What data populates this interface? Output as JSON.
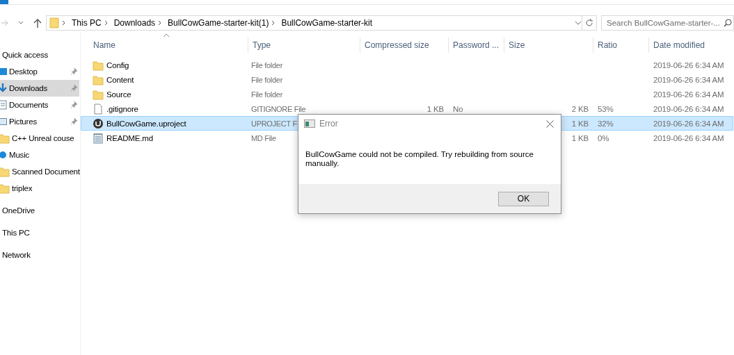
{
  "address_bar": {
    "path": [
      "This PC",
      "Downloads",
      "BullCowGame-starter-kit(1)",
      "BullCowGame-starter-kit"
    ]
  },
  "search": {
    "placeholder": "Search BullCowGame-starter-..."
  },
  "sidebar": {
    "items": [
      {
        "label": "Quick access",
        "kind": "header",
        "selected": false,
        "pinned": false
      },
      {
        "label": "Desktop",
        "kind": "desktop",
        "selected": false,
        "pinned": true
      },
      {
        "label": "Downloads",
        "kind": "downloads",
        "selected": true,
        "pinned": true
      },
      {
        "label": "Documents",
        "kind": "documents",
        "selected": false,
        "pinned": true
      },
      {
        "label": "Pictures",
        "kind": "pictures",
        "selected": false,
        "pinned": true
      },
      {
        "label": "C++ Unreal couse",
        "kind": "folder",
        "selected": false,
        "pinned": false
      },
      {
        "label": "Music",
        "kind": "music",
        "selected": false,
        "pinned": false
      },
      {
        "label": "Scanned Document",
        "kind": "folder",
        "selected": false,
        "pinned": false
      },
      {
        "label": "triplex",
        "kind": "folder",
        "selected": false,
        "pinned": false
      },
      {
        "label": "OneDrive",
        "kind": "header",
        "selected": false,
        "pinned": false
      },
      {
        "label": "This PC",
        "kind": "header",
        "selected": false,
        "pinned": false
      },
      {
        "label": "Network",
        "kind": "header",
        "selected": false,
        "pinned": false
      }
    ]
  },
  "table": {
    "columns": [
      "Name",
      "Type",
      "Compressed size",
      "Password ...",
      "Size",
      "Ratio",
      "Date modified"
    ],
    "rows": [
      {
        "kind": "folder",
        "selected": false,
        "name": "Config",
        "type": "File folder",
        "date": "2019-06-26 6:34 AM"
      },
      {
        "kind": "folder",
        "selected": false,
        "name": "Content",
        "type": "File folder",
        "date": "2019-06-26 6:34 AM"
      },
      {
        "kind": "folder",
        "selected": false,
        "name": "Source",
        "type": "File folder",
        "date": "2019-06-26 6:34 AM"
      },
      {
        "kind": "file",
        "selected": false,
        "name": ".gitignore",
        "type": "GITIGNORE File",
        "compressed_size": "1 KB",
        "password": "No",
        "size": "2 KB",
        "ratio": "53%",
        "date": "2019-06-26 6:34 AM"
      },
      {
        "kind": "unreal",
        "selected": true,
        "name": "BullCowGame.uproject",
        "type": "UPROJECT F",
        "size": "1 KB",
        "ratio": "32%",
        "date": "2019-06-26 6:34 AM"
      },
      {
        "kind": "text",
        "selected": false,
        "name": "README.md",
        "type": "MD File",
        "size": "1 KB",
        "ratio": "0%",
        "date": "2019-06-26 6:34 AM"
      }
    ]
  },
  "dialog": {
    "title": "Error",
    "message": "BullCowGame could not be compiled. Try rebuilding from source manually.",
    "buttons": [
      "OK"
    ]
  }
}
